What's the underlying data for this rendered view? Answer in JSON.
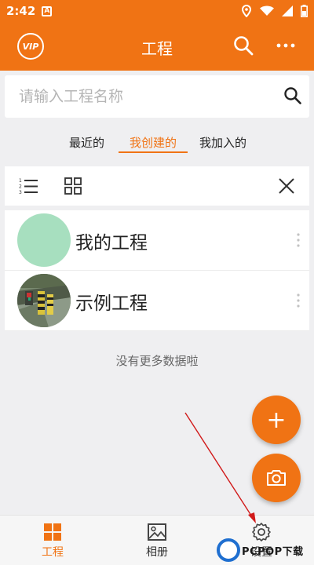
{
  "status_bar": {
    "time": "2:42",
    "notification_glyph": "A",
    "icons": [
      "location-icon",
      "wifi-icon",
      "signal-icon",
      "battery-icon"
    ]
  },
  "app_bar": {
    "vip_badge": "VIP",
    "title": "工程",
    "icons": [
      "search-icon",
      "more-icon"
    ]
  },
  "search": {
    "placeholder": "请输入工程名称",
    "value": ""
  },
  "tabs": [
    {
      "label": "最近的",
      "active": false
    },
    {
      "label": "我创建的",
      "active": true
    },
    {
      "label": "我加入的",
      "active": false
    }
  ],
  "toolbar": {
    "icons": [
      "list-view-icon",
      "grid-view-icon",
      "close-icon"
    ]
  },
  "projects": [
    {
      "name": "我的工程",
      "avatar": "green-placeholder"
    },
    {
      "name": "示例工程",
      "avatar": "road-photo"
    }
  ],
  "list_footer": "没有更多数据啦",
  "fab": {
    "add_glyph": "+",
    "camera_icon": "camera-icon"
  },
  "bottom_nav": [
    {
      "label": "工程",
      "icon": "projects-grid-icon",
      "active": true
    },
    {
      "label": "相册",
      "icon": "album-icon",
      "active": false
    },
    {
      "label": "设置",
      "icon": "gear-icon",
      "active": false
    }
  ],
  "watermark": {
    "text": "PCPOP下载"
  },
  "colors": {
    "accent": "#f07314",
    "background": "#efeff1",
    "annotation_arrow": "#d11a1a"
  }
}
